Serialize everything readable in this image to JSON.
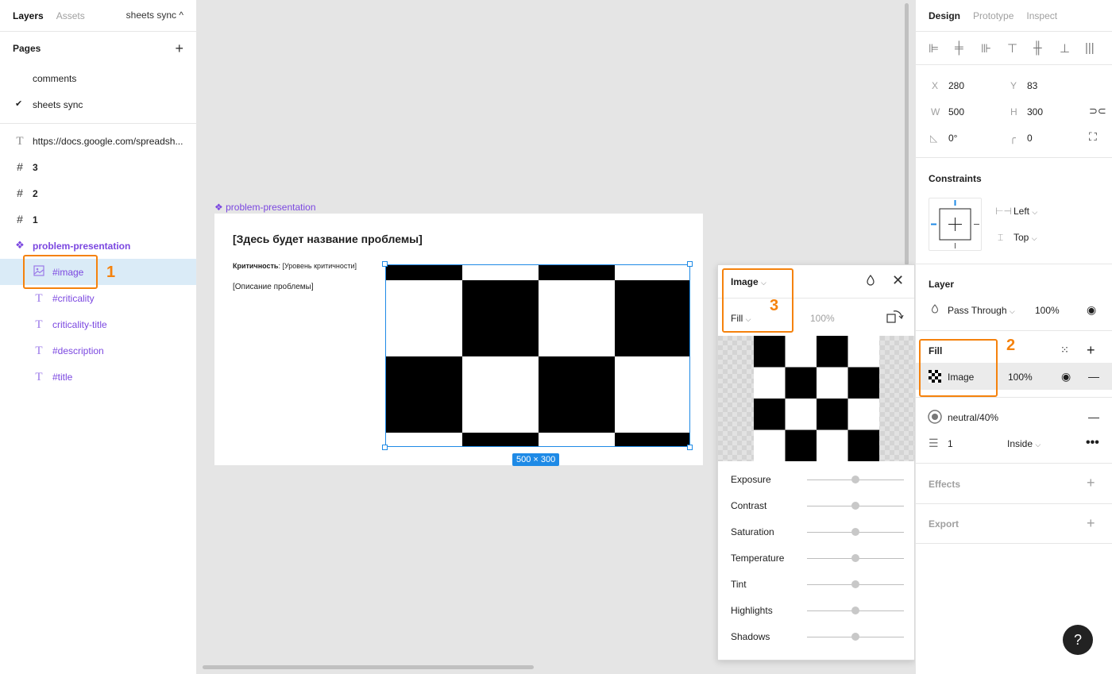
{
  "left_panel": {
    "tabs": [
      "Layers",
      "Assets"
    ],
    "page_switch": "sheets sync ^",
    "pages_heading": "Pages",
    "pages": [
      "comments",
      "sheets sync"
    ],
    "layers": [
      {
        "name": "https://docs.google.com/spreadsh...",
        "icon": "text-icon"
      },
      {
        "name": "3",
        "icon": "frame-icon"
      },
      {
        "name": "2",
        "icon": "frame-icon"
      },
      {
        "name": "1",
        "icon": "frame-icon"
      },
      {
        "name": "problem-presentation",
        "icon": "component-icon"
      },
      {
        "name": "#image",
        "icon": "image-icon"
      },
      {
        "name": "#criticality",
        "icon": "text-icon"
      },
      {
        "name": "criticality-title",
        "icon": "text-icon"
      },
      {
        "name": "#description",
        "icon": "text-icon"
      },
      {
        "name": "#title",
        "icon": "text-icon"
      }
    ]
  },
  "annotations": [
    "1",
    "2",
    "3"
  ],
  "canvas": {
    "frame_label": "problem-presentation",
    "title": "[Здесь будет название проблемы]",
    "criticality_label": "Критичность",
    "criticality_value": ": [Уровень критичности]",
    "description": "[Описание проблемы]",
    "dimensions": "500 × 300"
  },
  "image_popup": {
    "type": "Image",
    "mode": "Fill",
    "opacity": "100%",
    "adjustments": [
      "Exposure",
      "Contrast",
      "Saturation",
      "Temperature",
      "Tint",
      "Highlights",
      "Shadows"
    ]
  },
  "right_panel": {
    "tabs": [
      "Design",
      "Prototype",
      "Inspect"
    ],
    "x_label": "X",
    "x": "280",
    "y_label": "Y",
    "y": "83",
    "w_label": "W",
    "w": "500",
    "h_label": "H",
    "h": "300",
    "rotation": "0°",
    "radius": "0",
    "constraints_title": "Constraints",
    "constraint_h": "Left",
    "constraint_v": "Top",
    "layer_title": "Layer",
    "blend": "Pass Through",
    "layer_opacity": "100%",
    "fill_title": "Fill",
    "fill_type": "Image",
    "fill_opacity": "100%",
    "stroke_color": "neutral/40%",
    "stroke_width": "1",
    "stroke_position": "Inside",
    "effects_title": "Effects",
    "export_title": "Export"
  },
  "help": "?",
  "colors": {
    "accent": "#1e8ae6",
    "component": "#7b47e0",
    "annotation": "#f5820d",
    "selected_row": "#daebf7"
  }
}
